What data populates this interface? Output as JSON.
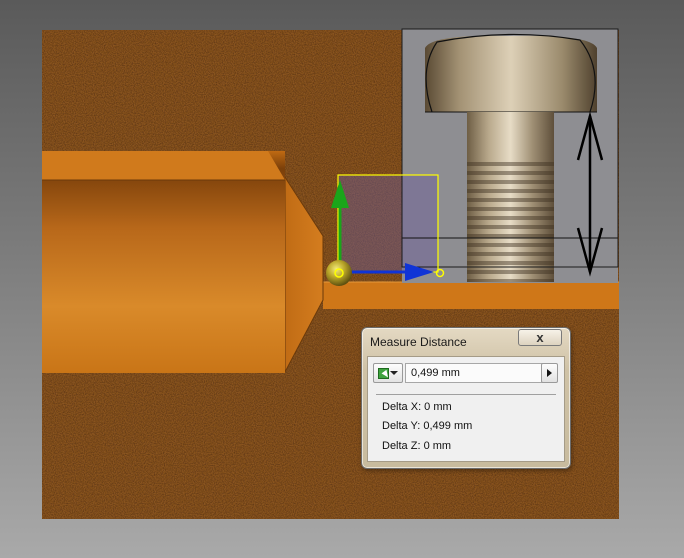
{
  "dialog": {
    "title": "Measure Distance",
    "close_label": "x",
    "distance_value": "0,499 mm",
    "mode_icon": "select-point-icon",
    "delta_x": "Delta X: 0 mm",
    "delta_y": "Delta Y: 0,499 mm",
    "delta_z": "Delta Z: 0 mm"
  },
  "colors": {
    "background": "#7c7c7c",
    "part_orange": "#c56f14",
    "texture_brown": "#8a5421",
    "x_axis": "#1034d6",
    "y_axis": "#1aa51a",
    "highlight": "#ffff00",
    "preview_border": "#1a1a1a"
  }
}
